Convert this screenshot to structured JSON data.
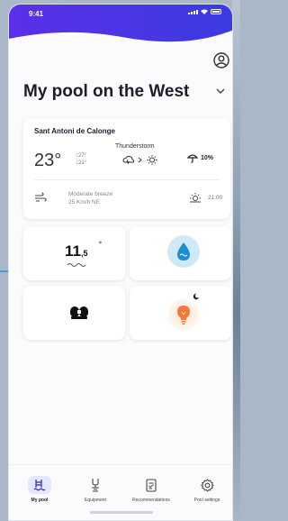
{
  "status_bar": {
    "time": "9:41"
  },
  "pool": {
    "title": "My pool on the West"
  },
  "weather": {
    "location": "Sant Antoni de Calonge",
    "temperature": "23°",
    "high": "↑27°",
    "low": "↓21°",
    "condition": "Thunderstorm",
    "rain_probability": "10%",
    "wind": "Moderate breeze",
    "wind_detail": "25 Km/h NE",
    "sunset_time": "21:00"
  },
  "tiles": {
    "temperature": {
      "whole": "11",
      "decimal": ",5",
      "unit": "°"
    }
  },
  "nav": {
    "items": [
      {
        "label": "My pool"
      },
      {
        "label": "Equipment"
      },
      {
        "label": "Recommendations"
      },
      {
        "label": "Pool settings"
      }
    ]
  },
  "colors": {
    "header": "#4c2ee6",
    "accent_nav": "#e5e7fb",
    "water": "#1e8fd6",
    "bulb": "#f07a3a"
  },
  "icons": [
    "profile-icon",
    "chevron-down-icon",
    "storm-cloud-icon",
    "sun-icon",
    "umbrella-rain-icon",
    "wind-icon",
    "sunset-icon",
    "water-drop-icon",
    "pump-icon",
    "light-bulb-icon",
    "moon-icon",
    "pool-ladder-icon",
    "equipment-icon",
    "recommendations-icon",
    "settings-gear-icon"
  ]
}
